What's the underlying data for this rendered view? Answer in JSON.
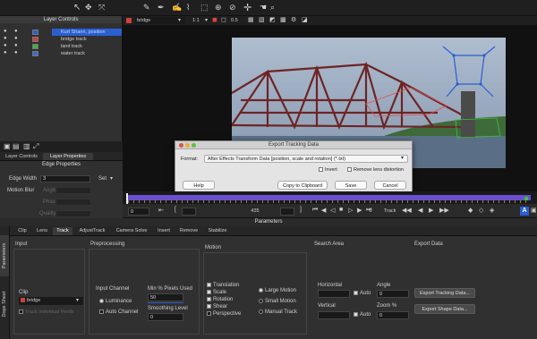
{
  "toolbar": {
    "layer_select": "bridge",
    "zoom_select": "1:1",
    "opacity_value": "0.5"
  },
  "layer_controls": {
    "title": "Layer Controls",
    "layers": [
      {
        "name": "Kurt Shann, position",
        "color": "#2a5fd0",
        "selected": true
      },
      {
        "name": "bridge track",
        "color": "#d04040",
        "selected": false
      },
      {
        "name": "land track",
        "color": "#40b040",
        "selected": false
      },
      {
        "name": "water track",
        "color": "#3a6ad8",
        "selected": false
      }
    ]
  },
  "tabs_left": {
    "layer_controls": "Layer Controls",
    "layer_properties": "Layer Properties"
  },
  "edge_properties": {
    "title": "Edge Properties",
    "edge_width_label": "Edge Width",
    "edge_width_value": "3",
    "set_label": "Set",
    "motion_blur_label": "Motion Blur",
    "angle_label": "Angle",
    "phase_label": "Phase",
    "quality_label": "Quality"
  },
  "dialog": {
    "title": "Export Tracking Data",
    "format_label": "Format:",
    "format_value": "After Effects Transform Data [position, scale and rotation] (*.txt)",
    "invert_label": "Invert",
    "remove_lens_label": "Remove lens distortion",
    "help": "Help",
    "copy": "Copy to Clipboard",
    "save": "Save",
    "cancel": "Cancel"
  },
  "timeline": {
    "start_frame": "0",
    "mid_frame": "435",
    "end_frame": "0",
    "track_label": "Track"
  },
  "params": {
    "title": "Parameters",
    "side_tab_params": "Parameters",
    "side_tab_dope": "Dope Sheet",
    "tabs": [
      "Clip",
      "Lens",
      "Track",
      "AdjustTrack",
      "Camera Solve",
      "Insert",
      "Remove",
      "Stabilize"
    ],
    "active_tab": "Track",
    "input_title": "Input",
    "preprocessing_title": "Preprocessing",
    "motion_title": "Motion",
    "search_area_title": "Search Area",
    "export_data_title": "Export Data",
    "input_channel_label": "Input Channel",
    "luminance_label": "Luminance",
    "auto_channel_label": "Auto Channel",
    "min_pixels_label": "Min % Pixels Used",
    "min_pixels_value": "50",
    "smoothing_label": "Smoothing Level",
    "smoothing_value": "0",
    "clip_label": "Clip",
    "clip_value": "bridge",
    "track_individual_label": "Track Individual Fields",
    "motion_options": [
      "Translation",
      "Scale",
      "Rotation",
      "Shear",
      "Perspective"
    ],
    "motion_checked": [
      true,
      true,
      true,
      true,
      false
    ],
    "motion_modes": [
      "Large Motion",
      "Small Motion",
      "Manual Track"
    ],
    "horizontal_label": "Horizontal",
    "vertical_label": "Vertical",
    "auto_label": "Auto",
    "angle_label": "Angle",
    "angle_value": "0",
    "zoom_label": "Zoom %",
    "zoom_value": "0",
    "export_tracking_button": "Export Tracking Data...",
    "export_shape_button": "Export Shape Data..."
  },
  "colors": {
    "accent_blue": "#2a5fd0",
    "timeline_purple": "#6a4fd0",
    "sky": "#9cb0c8",
    "bridge_red": "#7a2b2b"
  }
}
